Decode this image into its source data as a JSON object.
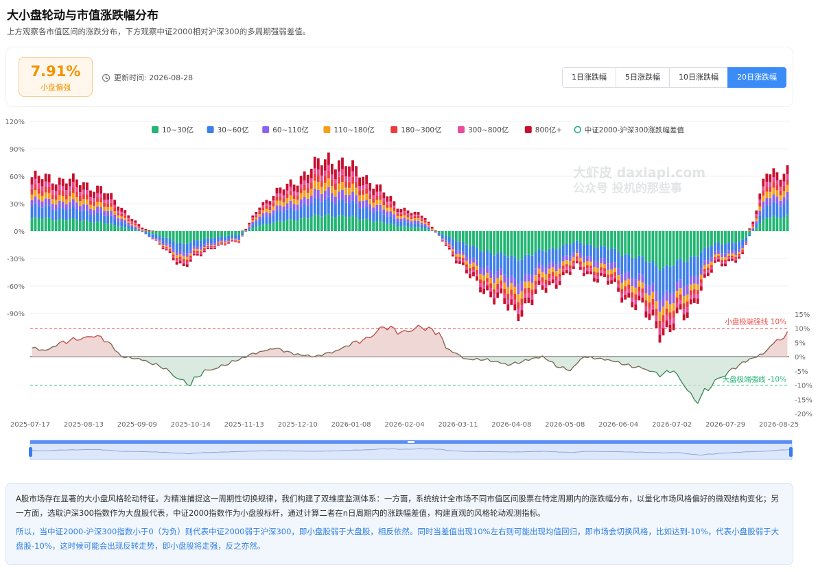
{
  "header": {
    "title": "大小盘轮动与市值涨跌幅分布",
    "subtitle": "上方观察各市值区间的涨跌分布，下方观察中证2000相对沪深300的多周期强弱差值。"
  },
  "summary": {
    "value": "7.91%",
    "label": "小盘偏强",
    "update_time": "更新时间: 2026-08-28",
    "tabs": [
      "1日涨跌幅",
      "5日涨跌幅",
      "10日涨跌幅",
      "20日涨跌幅"
    ],
    "active_tab": 3
  },
  "watermark": {
    "line1": "大虾皮 daxiapi.com",
    "line2": "公众号 投机的那些事"
  },
  "chart_data": [
    {
      "type": "bar",
      "stacked": true,
      "legend_position": "top-center",
      "grid": true,
      "ylim": [
        -120,
        120
      ],
      "yticks": [
        "-90%",
        "-60%",
        "-30%",
        "0%",
        "30%",
        "60%",
        "90%",
        "120%"
      ],
      "series": [
        {
          "name": "10~30亿",
          "color": "#22b573",
          "keyframes": [
            [
              0,
              14
            ],
            [
              10,
              13
            ],
            [
              20,
              10
            ],
            [
              28,
              3
            ],
            [
              34,
              -2
            ],
            [
              40,
              -9
            ],
            [
              44,
              -14
            ],
            [
              52,
              -7
            ],
            [
              60,
              -4
            ],
            [
              66,
              7
            ],
            [
              76,
              13
            ],
            [
              86,
              18
            ],
            [
              96,
              14
            ],
            [
              106,
              6
            ],
            [
              114,
              3
            ],
            [
              120,
              -5
            ],
            [
              128,
              -18
            ],
            [
              134,
              -24
            ],
            [
              140,
              -30
            ],
            [
              148,
              -22
            ],
            [
              158,
              -12
            ],
            [
              168,
              -20
            ],
            [
              176,
              -30
            ],
            [
              184,
              -40
            ],
            [
              190,
              -31
            ],
            [
              198,
              -14
            ],
            [
              206,
              -11
            ],
            [
              213,
              15
            ],
            [
              219,
              17
            ]
          ]
        },
        {
          "name": "30~60亿",
          "color": "#3d7fea",
          "keyframes": [
            [
              0,
              13
            ],
            [
              10,
              12
            ],
            [
              20,
              9
            ],
            [
              28,
              4
            ],
            [
              34,
              -3
            ],
            [
              40,
              -7
            ],
            [
              44,
              -10
            ],
            [
              52,
              -5
            ],
            [
              60,
              -4
            ],
            [
              66,
              7
            ],
            [
              76,
              12
            ],
            [
              86,
              18
            ],
            [
              96,
              13
            ],
            [
              106,
              6
            ],
            [
              114,
              3
            ],
            [
              120,
              -5
            ],
            [
              128,
              -15
            ],
            [
              134,
              -19
            ],
            [
              140,
              -24
            ],
            [
              148,
              -17
            ],
            [
              158,
              -11
            ],
            [
              168,
              -16
            ],
            [
              176,
              -22
            ],
            [
              184,
              -30
            ],
            [
              190,
              -24
            ],
            [
              198,
              -10
            ],
            [
              206,
              -8
            ],
            [
              213,
              14
            ],
            [
              219,
              15
            ]
          ]
        },
        {
          "name": "60~110亿",
          "color": "#8a63f0",
          "keyframes": [
            [
              0,
              7
            ],
            [
              10,
              7
            ],
            [
              20,
              6
            ],
            [
              28,
              3
            ],
            [
              34,
              -1
            ],
            [
              40,
              -3
            ],
            [
              44,
              -4
            ],
            [
              52,
              -2
            ],
            [
              60,
              -1
            ],
            [
              66,
              4
            ],
            [
              76,
              7
            ],
            [
              86,
              10
            ],
            [
              96,
              8
            ],
            [
              106,
              4
            ],
            [
              114,
              2
            ],
            [
              120,
              -2
            ],
            [
              128,
              -6
            ],
            [
              134,
              -8
            ],
            [
              140,
              -10
            ],
            [
              148,
              -7
            ],
            [
              158,
              -5
            ],
            [
              168,
              -7
            ],
            [
              176,
              -9
            ],
            [
              184,
              -12
            ],
            [
              190,
              -10
            ],
            [
              198,
              -4
            ],
            [
              206,
              -3
            ],
            [
              213,
              8
            ],
            [
              219,
              8
            ]
          ]
        },
        {
          "name": "110~180亿",
          "color": "#f5a01a",
          "keyframes": [
            [
              0,
              6
            ],
            [
              10,
              6
            ],
            [
              20,
              5
            ],
            [
              28,
              2
            ],
            [
              34,
              0
            ],
            [
              40,
              -2
            ],
            [
              44,
              -3
            ],
            [
              52,
              -1
            ],
            [
              60,
              -1
            ],
            [
              66,
              3
            ],
            [
              76,
              6
            ],
            [
              86,
              9
            ],
            [
              96,
              7
            ],
            [
              106,
              3
            ],
            [
              114,
              2
            ],
            [
              120,
              -1
            ],
            [
              128,
              -5
            ],
            [
              134,
              -6
            ],
            [
              140,
              -8
            ],
            [
              148,
              -6
            ],
            [
              158,
              -4
            ],
            [
              168,
              -5
            ],
            [
              176,
              -7
            ],
            [
              184,
              -9
            ],
            [
              190,
              -7
            ],
            [
              198,
              -3
            ],
            [
              206,
              -2
            ],
            [
              213,
              7
            ],
            [
              219,
              7
            ]
          ]
        },
        {
          "name": "180~300亿",
          "color": "#ea3e3e",
          "keyframes": [
            [
              0,
              6
            ],
            [
              10,
              6
            ],
            [
              20,
              5
            ],
            [
              28,
              2
            ],
            [
              34,
              0
            ],
            [
              40,
              -2
            ],
            [
              44,
              -3
            ],
            [
              52,
              -1
            ],
            [
              60,
              -1
            ],
            [
              66,
              3
            ],
            [
              76,
              5
            ],
            [
              86,
              8
            ],
            [
              96,
              6
            ],
            [
              106,
              3
            ],
            [
              114,
              2
            ],
            [
              120,
              -1
            ],
            [
              128,
              -4
            ],
            [
              134,
              -5
            ],
            [
              140,
              -7
            ],
            [
              148,
              -5
            ],
            [
              158,
              -3
            ],
            [
              168,
              -4
            ],
            [
              176,
              -6
            ],
            [
              184,
              -8
            ],
            [
              190,
              -6
            ],
            [
              198,
              -2
            ],
            [
              206,
              -2
            ],
            [
              213,
              6
            ],
            [
              219,
              6
            ]
          ]
        },
        {
          "name": "300~800亿",
          "color": "#ea4b9b",
          "keyframes": [
            [
              0,
              5
            ],
            [
              10,
              5
            ],
            [
              20,
              4
            ],
            [
              28,
              2
            ],
            [
              34,
              0
            ],
            [
              40,
              -1
            ],
            [
              44,
              -2
            ],
            [
              52,
              -1
            ],
            [
              60,
              -1
            ],
            [
              66,
              2
            ],
            [
              76,
              4
            ],
            [
              86,
              6
            ],
            [
              96,
              5
            ],
            [
              106,
              2
            ],
            [
              114,
              1
            ],
            [
              120,
              -1
            ],
            [
              128,
              -3
            ],
            [
              134,
              -4
            ],
            [
              140,
              -5
            ],
            [
              148,
              -4
            ],
            [
              158,
              -3
            ],
            [
              168,
              -3
            ],
            [
              176,
              -5
            ],
            [
              184,
              -6
            ],
            [
              190,
              -5
            ],
            [
              198,
              -2
            ],
            [
              206,
              -1
            ],
            [
              213,
              5
            ],
            [
              219,
              5
            ]
          ]
        },
        {
          "name": "800亿+",
          "color": "#c8102e",
          "keyframes": [
            [
              0,
              8
            ],
            [
              10,
              8
            ],
            [
              20,
              8
            ],
            [
              28,
              3
            ],
            [
              34,
              1
            ],
            [
              40,
              -2
            ],
            [
              44,
              -3
            ],
            [
              52,
              -1
            ],
            [
              60,
              0
            ],
            [
              66,
              3
            ],
            [
              76,
              8
            ],
            [
              86,
              13
            ],
            [
              96,
              10
            ],
            [
              106,
              4
            ],
            [
              114,
              2
            ],
            [
              120,
              -1
            ],
            [
              128,
              -5
            ],
            [
              134,
              -6
            ],
            [
              140,
              -7
            ],
            [
              148,
              -5
            ],
            [
              158,
              -3
            ],
            [
              168,
              -4
            ],
            [
              176,
              -6
            ],
            [
              184,
              -8
            ],
            [
              190,
              -6
            ],
            [
              198,
              -3
            ],
            [
              206,
              -2
            ],
            [
              213,
              9
            ],
            [
              219,
              9
            ]
          ]
        }
      ]
    },
    {
      "type": "line",
      "series": [
        {
          "name": "中证2000-沪深300涨跌幅差值",
          "color": "#9b3a3a",
          "keyframes": [
            [
              0,
              3
            ],
            [
              4,
              2
            ],
            [
              8,
              5
            ],
            [
              14,
              6
            ],
            [
              18,
              8
            ],
            [
              22,
              5
            ],
            [
              26,
              0
            ],
            [
              32,
              -1
            ],
            [
              38,
              -4
            ],
            [
              42,
              -7
            ],
            [
              46,
              -10
            ],
            [
              50,
              -5
            ],
            [
              56,
              -3
            ],
            [
              60,
              -1
            ],
            [
              64,
              1
            ],
            [
              70,
              3
            ],
            [
              76,
              1
            ],
            [
              82,
              0
            ],
            [
              88,
              2
            ],
            [
              96,
              6
            ],
            [
              102,
              10
            ],
            [
              108,
              9
            ],
            [
              114,
              10
            ],
            [
              118,
              9
            ],
            [
              120,
              3
            ],
            [
              126,
              -1
            ],
            [
              132,
              -1
            ],
            [
              138,
              -3
            ],
            [
              144,
              -1
            ],
            [
              148,
              0
            ],
            [
              152,
              -3
            ],
            [
              156,
              -5
            ],
            [
              160,
              0
            ],
            [
              166,
              -1
            ],
            [
              170,
              -2
            ],
            [
              176,
              -4
            ],
            [
              182,
              -6
            ],
            [
              186,
              -5
            ],
            [
              188,
              -9
            ],
            [
              190,
              -11
            ],
            [
              192,
              -15
            ],
            [
              196,
              -12
            ],
            [
              198,
              -9
            ],
            [
              202,
              -5
            ],
            [
              208,
              -1
            ],
            [
              212,
              1
            ],
            [
              216,
              6
            ],
            [
              219,
              7.9
            ]
          ]
        }
      ],
      "ylim": [
        -20,
        15
      ],
      "yticks": [
        "-20%",
        "-15%",
        "-10%",
        "-5%",
        "0%",
        "5%",
        "10%",
        "15%"
      ],
      "reference_lines": [
        {
          "value": 10,
          "label": "小盘极端强线 10%",
          "color": "#ef5350"
        },
        {
          "value": -10,
          "label": "大盘极端强线 -10%",
          "color": "#22b573"
        }
      ],
      "x_labels": [
        "2025-07-17",
        "2025-08-13",
        "2025-09-09",
        "2025-10-14",
        "2025-11-13",
        "2025-12-10",
        "2026-01-08",
        "2026-02-04",
        "2026-03-11",
        "2026-04-08",
        "2026-05-08",
        "2026-06-04",
        "2026-07-02",
        "2026-07-29",
        "2026-08-25"
      ]
    }
  ],
  "description": {
    "para1": "A股市场存在显著的大小盘风格轮动特征。为精准捕捉这一周期性切换规律，我们构建了双维度监测体系：一方面，系统统计全市场不同市值区间股票在特定周期内的涨跌幅分布，以量化市场风格偏好的微观结构变化；另一方面，选取沪深300指数作为大盘股代表，中证2000指数作为小盘股标杆，通过计算二者在n日周期内的涨跌幅差值，构建直观的风格轮动观测指标。",
    "para2_lead": "所以，",
    "para2_body": "当中证2000-沪深300指数小于0（为负）则代表中证2000弱于沪深300，即小盘股弱于大盘股，相反依然。同时当差值出现10%左右则可能出现均值回归，即市场会切换风格，比如达到-10%，代表小盘股弱于大盘股-10%，这时候可能会出现反转走势，即小盘股将走强，反之亦然。"
  },
  "colors": {
    "accent": "#3b8cf7",
    "metric": "#f39200",
    "info_text": "#2f7fe4"
  }
}
